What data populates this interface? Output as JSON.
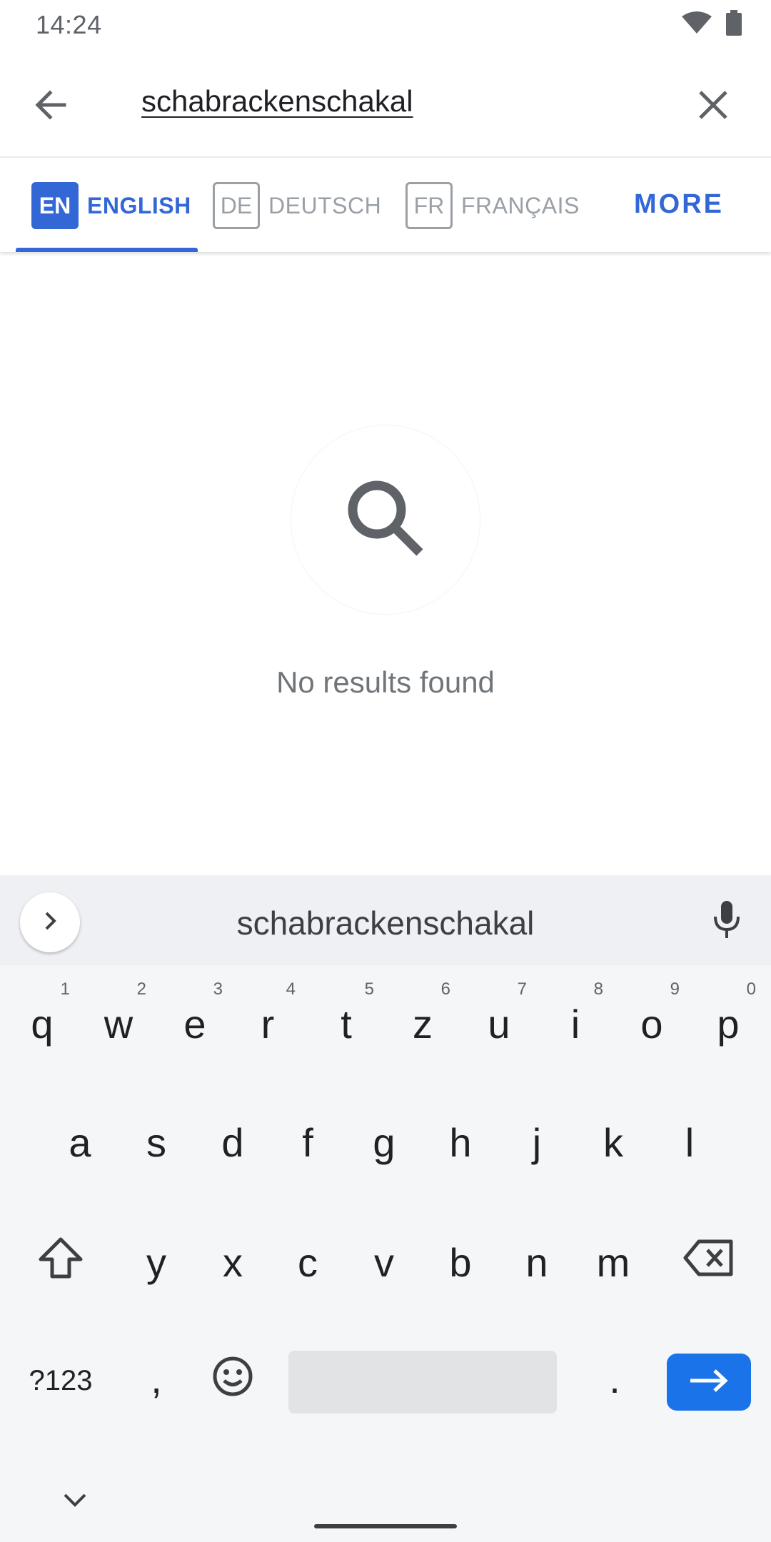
{
  "status_bar": {
    "time": "14:24",
    "icons": [
      "wifi-icon",
      "battery-icon"
    ]
  },
  "search": {
    "query": "schabrackenschakal",
    "back_icon": "arrow-left-icon",
    "clear_icon": "close-icon"
  },
  "language_tabs": {
    "tabs": [
      {
        "code": "EN",
        "label": "ENGLISH",
        "selected": true
      },
      {
        "code": "DE",
        "label": "DEUTSCH",
        "selected": false
      },
      {
        "code": "FR",
        "label": "FRANÇAIS",
        "selected": false
      }
    ],
    "more_label": "MORE"
  },
  "empty_state": {
    "icon": "search-icon",
    "message": "No results found"
  },
  "keyboard": {
    "suggestion": "schabrackenschakal",
    "row1": [
      {
        "key": "q",
        "hint": "1"
      },
      {
        "key": "w",
        "hint": "2"
      },
      {
        "key": "e",
        "hint": "3"
      },
      {
        "key": "r",
        "hint": "4"
      },
      {
        "key": "t",
        "hint": "5"
      },
      {
        "key": "z",
        "hint": "6"
      },
      {
        "key": "u",
        "hint": "7"
      },
      {
        "key": "i",
        "hint": "8"
      },
      {
        "key": "o",
        "hint": "9"
      },
      {
        "key": "p",
        "hint": "0"
      }
    ],
    "row2": [
      "a",
      "s",
      "d",
      "f",
      "g",
      "h",
      "j",
      "k",
      "l"
    ],
    "row3": [
      "y",
      "x",
      "c",
      "v",
      "b",
      "n",
      "m"
    ],
    "symbols_label": "?123",
    "comma": ",",
    "period": ".",
    "colors": {
      "enter": "#1a73e8",
      "accent": "#3367d6"
    }
  }
}
